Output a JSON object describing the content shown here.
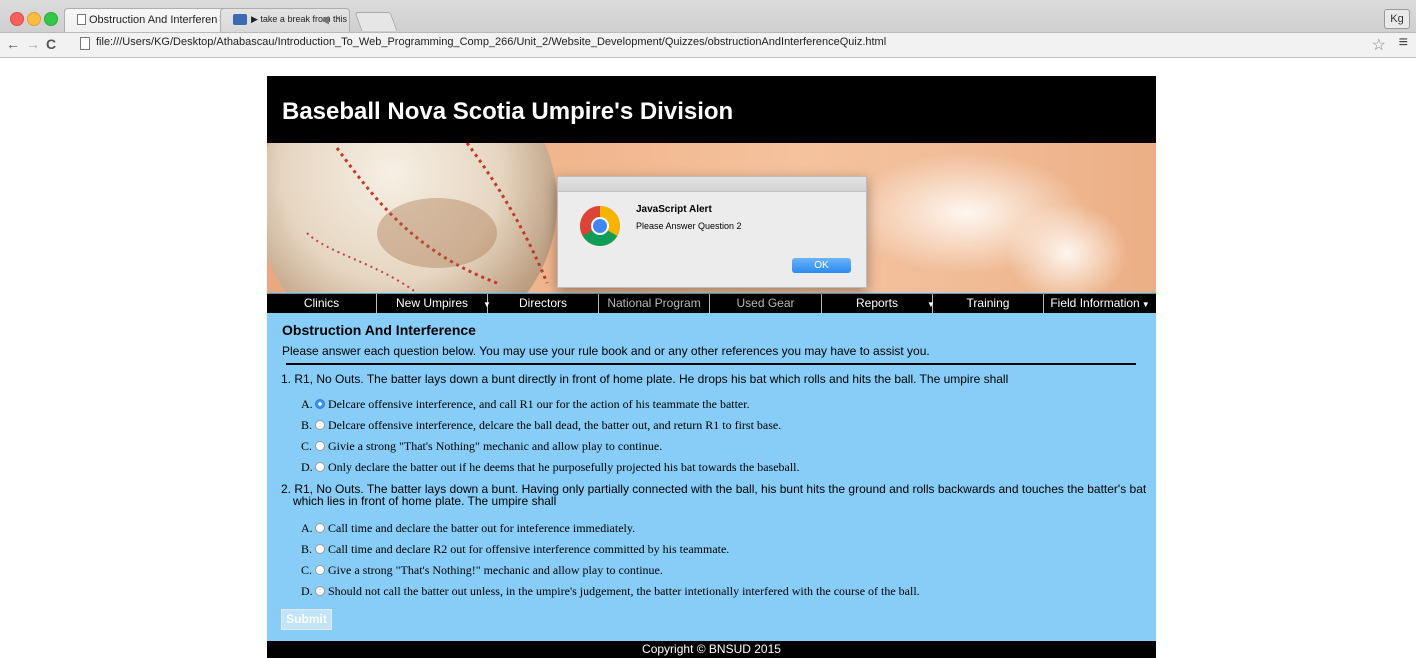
{
  "browser": {
    "tabs": [
      {
        "title": "Obstruction And Interferen",
        "close": "×"
      },
      {
        "title": "▶ take a break from this",
        "close": "×"
      }
    ],
    "profile": "Kg",
    "url": "file:///Users/KG/Desktop/Athabascau/Introduction_To_Web_Programming_Comp_266/Unit_2/Website_Development/Quizzes/obstructionAndInterferenceQuiz.html"
  },
  "site": {
    "title": "Baseball Nova Scotia Umpire's Division",
    "nav": [
      {
        "label": "Clinics"
      },
      {
        "label": "New Umpires",
        "dropdown": true
      },
      {
        "label": "Directors"
      },
      {
        "label": "National Program"
      },
      {
        "label": "Used Gear"
      },
      {
        "label": "Reports",
        "dropdown": true
      },
      {
        "label": "Training"
      },
      {
        "label": "Field Information",
        "dropdown": true
      }
    ],
    "quiz": {
      "title": "Obstruction And Interference",
      "instructions": "Please answer each question below. You may use your rule book and or any other references you may have to assist you.",
      "questions": [
        {
          "text": "1.  R1, No Outs. The batter lays down a bunt directly in front of home plate. He drops his bat which rolls and hits the ball. The umpire shall",
          "options": [
            {
              "letter": "A.",
              "text": "Delcare offensive interference, and call R1 our for the action of his teammate the batter.",
              "selected": true
            },
            {
              "letter": "B.",
              "text": "Delcare offensive interference, delcare the ball dead, the batter out, and return R1 to first base.",
              "selected": false
            },
            {
              "letter": "C.",
              "text": "Givie a strong \"That's Nothing\" mechanic and allow play to continue.",
              "selected": false
            },
            {
              "letter": "D.",
              "text": "Only declare the batter out if he deems that he purposefully projected his bat towards the baseball.",
              "selected": false
            }
          ]
        },
        {
          "text_line1": "2.  R1, No Outs. The batter lays down a bunt. Having only partially connected with the ball, his bunt hits the ground and rolls backwards and touches the batter's bat",
          "text_line2": "which lies in front of home plate. The umpire shall",
          "options": [
            {
              "letter": "A.",
              "text": "Call time and declare the batter out for inteference immediately.",
              "selected": false
            },
            {
              "letter": "B.",
              "text": "Call time and declare R2 out for offensive interference committed by his teammate.",
              "selected": false
            },
            {
              "letter": "C.",
              "text": "Give a strong \"That's Nothing!\" mechanic and allow play to continue.",
              "selected": false
            },
            {
              "letter": "D.",
              "text": "Should not call the batter out unless, in the umpire's judgement, the batter intetionally interfered with the course of the ball.",
              "selected": false
            }
          ]
        }
      ],
      "submit_label": "Submit"
    },
    "footer": "Copyright © BNSUD 2015"
  },
  "alert": {
    "title": "JavaScript Alert",
    "message": "Please Answer Question 2",
    "ok_label": "OK"
  }
}
